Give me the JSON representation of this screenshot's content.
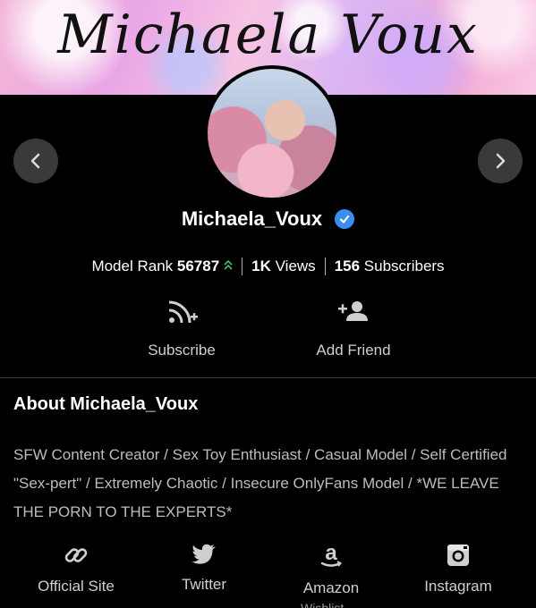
{
  "banner": {
    "title": "Michaela Voux"
  },
  "profile": {
    "username": "Michaela_Voux",
    "verified": true,
    "rank_label": "Model Rank",
    "rank_value": "56787",
    "rank_trend": "up",
    "views_value": "1K",
    "views_label": "Views",
    "subscribers_value": "156",
    "subscribers_label": "Subscribers"
  },
  "navigation": {
    "prev_icon": "chevron-left-icon",
    "next_icon": "chevron-right-icon"
  },
  "actions": {
    "subscribe_label": "Subscribe",
    "add_friend_label": "Add Friend"
  },
  "about": {
    "title": "About Michaela_Voux",
    "text": "SFW Content Creator / Sex Toy Enthusiast / Casual Model / Self Certified \"Sex-pert\" / Extremely Chaotic / Insecure OnlyFans Model / *WE LEAVE THE PORN TO THE EXPERTS*"
  },
  "social": [
    {
      "label": "Official Site",
      "icon": "link-icon"
    },
    {
      "label": "Twitter",
      "icon": "twitter-icon"
    },
    {
      "label": "Amazon",
      "icon": "amazon-icon"
    },
    {
      "label": "Instagram",
      "icon": "instagram-icon"
    }
  ],
  "social_overflow_text": "Wishlist",
  "colors": {
    "background": "#000000",
    "verified_badge": "#3a8ef0",
    "rank_up_arrow": "#3cc76b",
    "nav_button": "#3a3a3a"
  }
}
